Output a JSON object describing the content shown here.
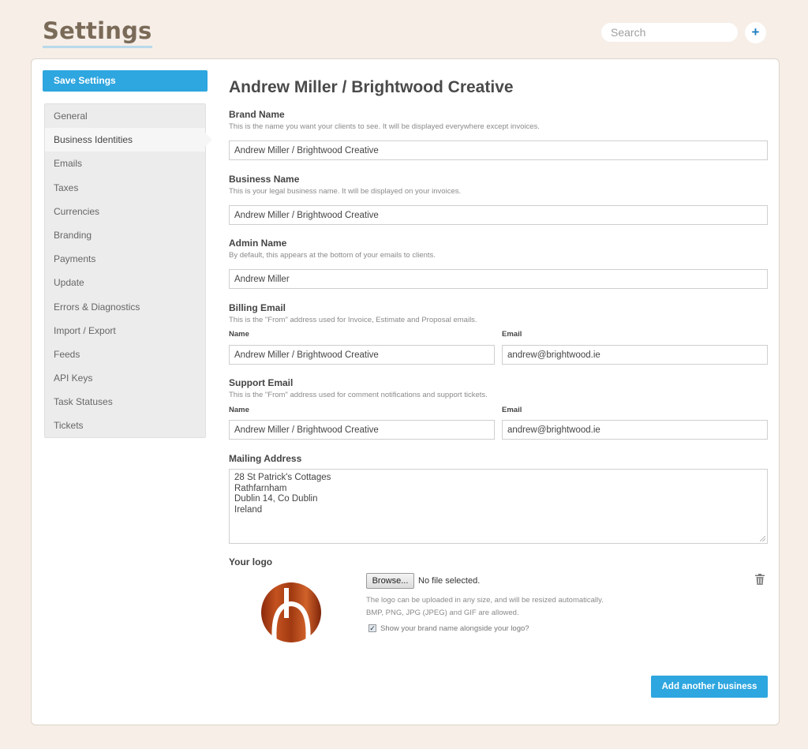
{
  "header": {
    "title": "Settings",
    "search_placeholder": "Search",
    "add_icon": "+"
  },
  "sidebar": {
    "save_label": "Save Settings",
    "items": [
      {
        "label": "General"
      },
      {
        "label": "Business Identities",
        "active": true
      },
      {
        "label": "Emails"
      },
      {
        "label": "Taxes"
      },
      {
        "label": "Currencies"
      },
      {
        "label": "Branding"
      },
      {
        "label": "Payments"
      },
      {
        "label": "Update"
      },
      {
        "label": "Errors & Diagnostics"
      },
      {
        "label": "Import / Export"
      },
      {
        "label": "Feeds"
      },
      {
        "label": "API Keys"
      },
      {
        "label": "Task Statuses"
      },
      {
        "label": "Tickets"
      }
    ]
  },
  "main": {
    "business_title": "Andrew Miller / Brightwood Creative",
    "brand_name": {
      "label": "Brand Name",
      "help": "This is the name you want your clients to see. It will be displayed everywhere except invoices.",
      "value": "Andrew Miller / Brightwood Creative"
    },
    "business_name": {
      "label": "Business Name",
      "help": "This is your legal business name. It will be displayed on your invoices.",
      "value": "Andrew Miller / Brightwood Creative"
    },
    "admin_name": {
      "label": "Admin Name",
      "help": "By default, this appears at the bottom of your emails to clients.",
      "value": "Andrew Miller"
    },
    "billing_email": {
      "label": "Billing Email",
      "help": "This is the \"From\" address used for Invoice, Estimate and Proposal emails.",
      "name_label": "Name",
      "email_label": "Email",
      "name_value": "Andrew Miller / Brightwood Creative",
      "email_value": "andrew@brightwood.ie"
    },
    "support_email": {
      "label": "Support Email",
      "help": "This is the \"From\" address used for comment notifications and support tickets.",
      "name_label": "Name",
      "email_label": "Email",
      "name_value": "Andrew Miller / Brightwood Creative",
      "email_value": "andrew@brightwood.ie"
    },
    "mailing_address": {
      "label": "Mailing Address",
      "value": "28 St Patrick's Cottages\nRathfarnham\nDublin 14, Co Dublin\nIreland"
    },
    "logo": {
      "label": "Your logo",
      "browse_label": "Browse...",
      "file_status": "No file selected.",
      "help_line1": "The logo can be uploaded in any size, and will be resized automatically.",
      "help_line2": "BMP, PNG, JPG (JPEG) and GIF are allowed.",
      "show_brand_label": "Show your brand name alongside your logo?",
      "show_brand_checked": true,
      "trash_icon": "trash-icon"
    },
    "add_business_label": "Add another business"
  },
  "colors": {
    "background": "#f6eee7",
    "accent": "#2ea6df",
    "title": "#7a6a58"
  }
}
